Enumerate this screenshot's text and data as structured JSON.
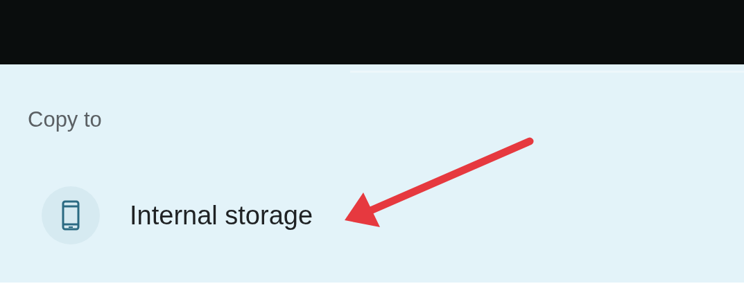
{
  "sheet": {
    "title": "Copy to",
    "items": [
      {
        "label": "Internal storage"
      }
    ]
  }
}
